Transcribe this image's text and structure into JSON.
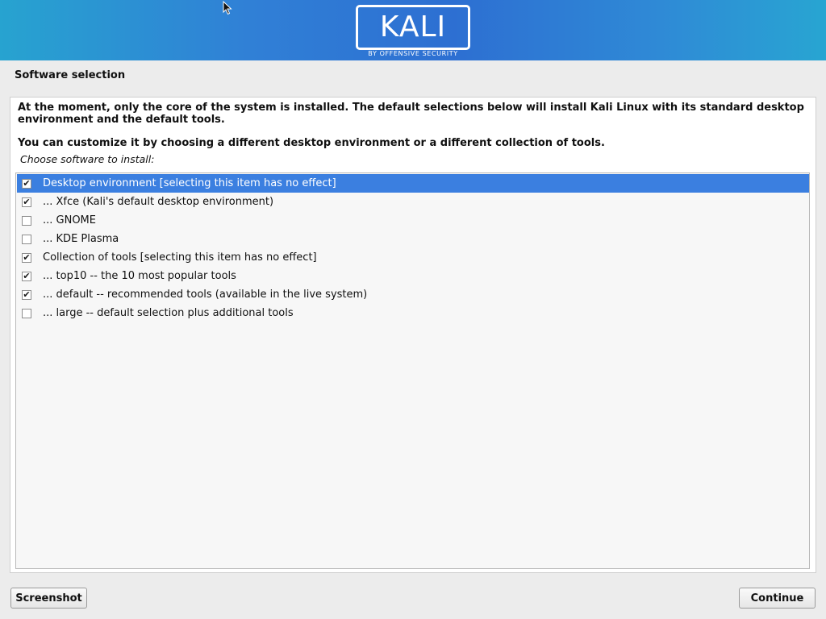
{
  "banner": {
    "logo_text": "KALI",
    "logo_subtitle": "BY OFFENSIVE SECURITY"
  },
  "page_title": "Software selection",
  "description": {
    "paragraph1": "At the moment, only the core of the system is installed. The default selections below will install Kali Linux with its standard desktop environment and the default tools.",
    "paragraph2": "You can customize it by choosing a different desktop environment or a different collection of tools."
  },
  "prompt": "Choose software to install:",
  "items": [
    {
      "label": "Desktop environment [selecting this item has no effect]",
      "checked": true,
      "selected": true
    },
    {
      "label": "... Xfce (Kali's default desktop environment)",
      "checked": true,
      "selected": false
    },
    {
      "label": "... GNOME",
      "checked": false,
      "selected": false
    },
    {
      "label": "... KDE Plasma",
      "checked": false,
      "selected": false
    },
    {
      "label": "Collection of tools [selecting this item has no effect]",
      "checked": true,
      "selected": false
    },
    {
      "label": "... top10 -- the 10 most popular tools",
      "checked": true,
      "selected": false
    },
    {
      "label": "... default -- recommended tools (available in the live system)",
      "checked": true,
      "selected": false
    },
    {
      "label": "... large -- default selection plus additional tools",
      "checked": false,
      "selected": false
    }
  ],
  "buttons": {
    "screenshot": "Screenshot",
    "continue": "Continue"
  },
  "colors": {
    "selection": "#3b7fe0",
    "banner_start": "#27a3d0",
    "banner_mid": "#2d6fd2"
  },
  "icons": {
    "check": "✔",
    "cursor": "mouse-pointer-icon"
  }
}
